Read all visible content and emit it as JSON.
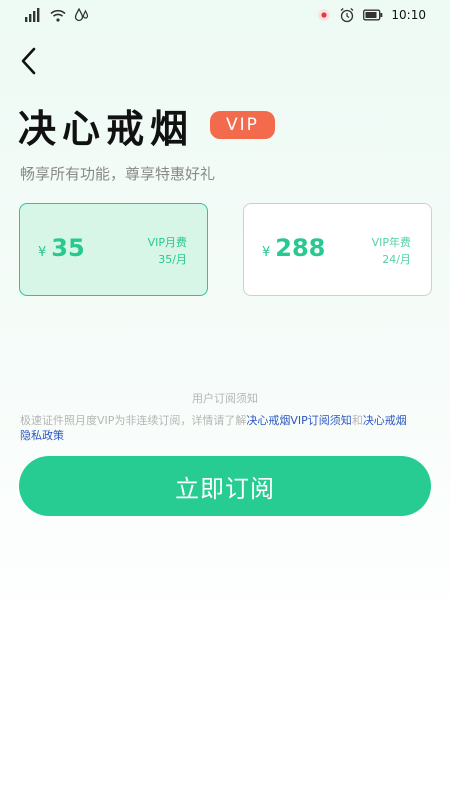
{
  "status_bar": {
    "time": "10:10"
  },
  "header": {
    "title": "决心戒烟",
    "badge": "VIP",
    "subtitle": "畅享所有功能，尊享特惠好礼"
  },
  "plans": [
    {
      "currency": "¥",
      "price": "35",
      "name": "VIP月费",
      "per": "35/月",
      "selected": true
    },
    {
      "currency": "¥",
      "price": "288",
      "name": "VIP年费",
      "per": "24/月",
      "selected": false
    }
  ],
  "notice": {
    "title": "用户订阅须知",
    "text_prefix": "极速证件照月度VIP为非连续订阅，详情请了解",
    "link1": "决心戒烟VIP订阅须知",
    "conj": "和",
    "link2": "决心戒烟隐私政策"
  },
  "subscribe_label": "立即订阅",
  "colors": {
    "accent": "#26cc92",
    "badge": "#f46a4c",
    "link": "#2b56c2"
  }
}
